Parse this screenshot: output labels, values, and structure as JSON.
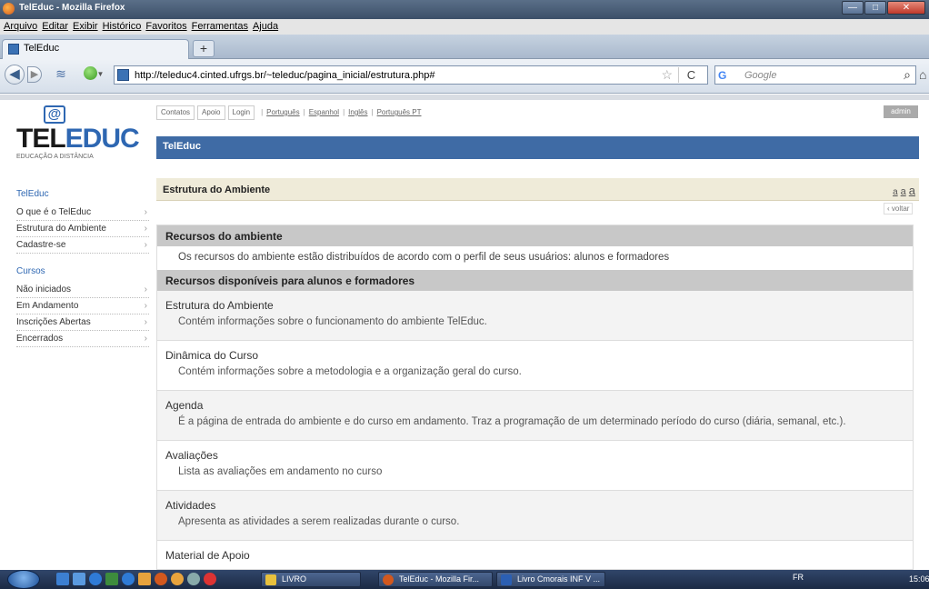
{
  "window": {
    "title": "TelEduc - Mozilla Firefox",
    "min": "—",
    "max": "□",
    "close": "✕"
  },
  "menu": [
    "Arquivo",
    "Editar",
    "Exibir",
    "Histórico",
    "Favoritos",
    "Ferramentas",
    "Ajuda"
  ],
  "tab": {
    "label": "TelEduc",
    "new_tab": "+"
  },
  "nav": {
    "back": "◀",
    "forward": "▶",
    "url": "http://teleduc4.cinted.ufrgs.br/~teleduc/pagina_inicial/estrutura.php#",
    "star": "☆",
    "reload": "C",
    "search_engine": "G",
    "search_placeholder": "Google",
    "search_icon": "⌕",
    "home": "⌂"
  },
  "logo": {
    "tel": "TEL",
    "educ": "EDUC",
    "at": "@",
    "tagline": "EDUCAÇÃO A DISTÂNCIA"
  },
  "toplinks": {
    "buttons": [
      "Contatos",
      "Apoio",
      "Login"
    ],
    "languages": [
      "Português",
      "Espanhol",
      "Inglês",
      "Português PT"
    ],
    "admin": "admin"
  },
  "header": {
    "title": "TelEduc"
  },
  "sidebar": {
    "section1_title": "TelEduc",
    "section1_items": [
      "O que é o TelEduc",
      "Estrutura do Ambiente",
      "Cadastre-se"
    ],
    "section2_title": "Cursos",
    "section2_items": [
      "Não iniciados",
      "Em Andamento",
      "Inscrições Abertas",
      "Encerrados"
    ]
  },
  "content": {
    "title": "Estrutura do Ambiente",
    "font_sizes": [
      "a",
      "a",
      "a"
    ],
    "voltar": "‹ voltar",
    "section1_head": "Recursos do ambiente",
    "section1_text": "Os recursos do ambiente estão distribuídos de acordo com o perfil de seus usuários: alunos e formadores",
    "section2_head": "Recursos disponíveis para alunos e formadores",
    "items": [
      {
        "title": "Estrutura do Ambiente",
        "desc": "Contém informações sobre o funcionamento do ambiente TelEduc."
      },
      {
        "title": "Dinâmica do Curso",
        "desc": "Contém informações sobre a metodologia e a organização geral do curso."
      },
      {
        "title": "Agenda",
        "desc": "É a página de entrada do ambiente e do curso em andamento. Traz a programação de um determinado período do curso (diária, semanal, etc.)."
      },
      {
        "title": "Avaliações",
        "desc": "Lista as avaliações em andamento no curso"
      },
      {
        "title": "Atividades",
        "desc": "Apresenta as atividades a serem realizadas durante o curso."
      },
      {
        "title": "Material de Apoio",
        "desc": ""
      }
    ]
  },
  "taskbar": {
    "buttons": [
      "LIVRO",
      "TelEduc - Mozilla Fir...",
      "Livro Cmorais INF V ..."
    ],
    "tray_lang": "FR",
    "clock": "15:06"
  }
}
